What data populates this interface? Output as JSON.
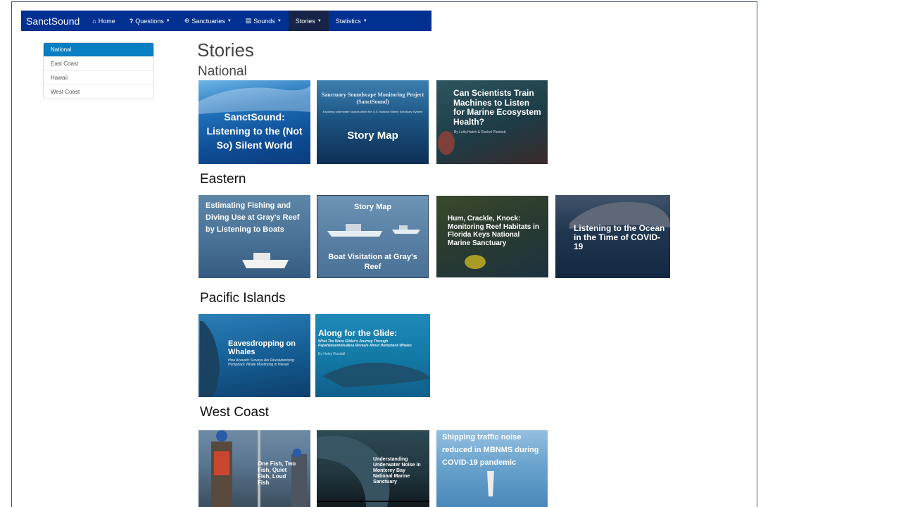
{
  "navbar": {
    "brand": "SanctSound",
    "items": [
      {
        "icon": "home-icon",
        "glyph": "🏠",
        "label": "Home",
        "dropdown": false
      },
      {
        "icon": "question-icon",
        "glyph": "?",
        "label": "Questions",
        "dropdown": true
      },
      {
        "icon": "globe-icon",
        "glyph": "⊕",
        "label": "Sanctuaries",
        "dropdown": true
      },
      {
        "icon": "file-icon",
        "glyph": "▤",
        "label": "Sounds",
        "dropdown": true
      },
      {
        "icon": "",
        "glyph": "",
        "label": "Stories",
        "dropdown": true,
        "active": true
      },
      {
        "icon": "",
        "glyph": "",
        "label": "Statistics",
        "dropdown": true
      }
    ]
  },
  "sidebar": {
    "items": [
      {
        "label": "National",
        "active": true
      },
      {
        "label": "East Coast"
      },
      {
        "label": "Hawaii"
      },
      {
        "label": "West Coast"
      }
    ]
  },
  "page": {
    "title": "Stories",
    "sections": {
      "national": "National",
      "eastern": "Eastern",
      "pacific": "Pacific Islands",
      "westcoast": "West Coast"
    }
  },
  "cards": {
    "sanctsound_silent_world": {
      "title": "SanctSound: Listening to the (Not So) Silent World"
    },
    "story_map_1": {
      "header": "Sanctuary Soundscape Monitoring Project (SanctSound)",
      "sub": "Exploring underwater sounds within the U.S. National Marine Sanctuary System",
      "title": "Story Map"
    },
    "scientists_train": {
      "title": "Can Scientists Train Machines to Listen for Marine Ecosystem Health?",
      "byline": "By Leila Hatch & Rachel Plunkett"
    },
    "estimating_fishing": {
      "title": "Estimating Fishing and Diving Use at Gray's Reef by Listening to Boats"
    },
    "boat_visitation": {
      "header": "Story Map",
      "title": "Boat Visitation at Gray's Reef"
    },
    "hum_crackle": {
      "title": "Hum, Crackle, Knock: Monitoring Reef Habitats in Florida Keys National Marine Sanctuary"
    },
    "listening_covid": {
      "title": "Listening to the Ocean in the Time of COVID-19"
    },
    "eavesdropping": {
      "title": "Eavesdropping on Whales",
      "sub": "How Acoustic Surveys Are Revolutionizing Humpback Whale Monitoring in Hawaii"
    },
    "along_glide": {
      "title": "Along for the Glide:",
      "sub": "What The Wave Glider's Journey Through Papahānaumokuākea Reveals About Humpback Whales",
      "byline": "By Haley Randall"
    },
    "one_fish": {
      "title": "One Fish, Two Fish, Quiet Fish, Loud Fish"
    },
    "understanding_noise": {
      "title": "Understanding Underwater Noise in Monterey Bay National Marine Sanctuary"
    },
    "shipping_traffic": {
      "title": "Shipping traffic noise reduced in MBNMS during COVID-19 pandemic"
    }
  }
}
